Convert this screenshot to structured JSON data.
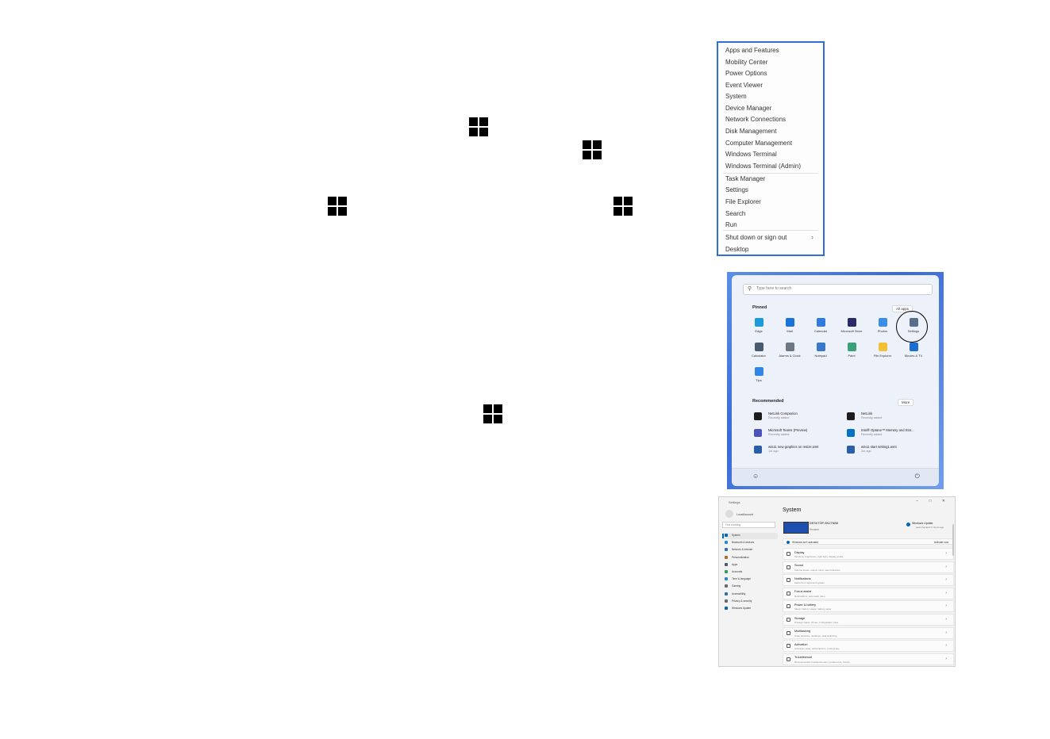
{
  "winx_menu": {
    "items": [
      {
        "label": "Apps and Features"
      },
      {
        "label": "Mobility Center"
      },
      {
        "label": "Power Options"
      },
      {
        "label": "Event Viewer"
      },
      {
        "label": "System"
      },
      {
        "label": "Device Manager"
      },
      {
        "label": "Network Connections"
      },
      {
        "label": "Disk Management"
      },
      {
        "label": "Computer Management"
      },
      {
        "label": "Windows Terminal"
      },
      {
        "label": "Windows Terminal (Admin)"
      },
      {
        "label": "Task Manager"
      },
      {
        "label": "Settings"
      },
      {
        "label": "File Explorer"
      },
      {
        "label": "Search"
      },
      {
        "label": "Run"
      },
      {
        "label": "Shut down or sign out",
        "submenu": true
      },
      {
        "label": "Desktop"
      }
    ]
  },
  "start_menu": {
    "search_placeholder": "Type here to search",
    "pinned_label": "Pinned",
    "all_apps_label": "All apps",
    "pinned_apps": [
      {
        "label": "Edge",
        "color": "#1b9bd8"
      },
      {
        "label": "Mail",
        "color": "#1a73d6"
      },
      {
        "label": "Calendar",
        "color": "#2f7be0"
      },
      {
        "label": "Microsoft Store",
        "color": "#2b2b6a"
      },
      {
        "label": "Photos",
        "color": "#3b8ee6"
      },
      {
        "label": "Settings",
        "color": "#5a6f8c"
      },
      {
        "label": "Calculator",
        "color": "#4a5a6e"
      },
      {
        "label": "Alarms & Clock",
        "color": "#6d7784"
      },
      {
        "label": "Notepad",
        "color": "#3a78c9"
      },
      {
        "label": "Paint",
        "color": "#3aa07a"
      },
      {
        "label": "File Explorer",
        "color": "#f2c035"
      },
      {
        "label": "Movies & TV",
        "color": "#1c6fd1"
      },
      {
        "label": "Tips",
        "color": "#2f86e8"
      }
    ],
    "recommended_label": "Recommended",
    "more_label": "More",
    "recommended": [
      {
        "title": "NetLink Companion",
        "sub": "Recently added",
        "color": "#1d1d1d"
      },
      {
        "title": "NetLink",
        "sub": "Recently added",
        "color": "#1d1d1d"
      },
      {
        "title": "Microsoft Teams (Preview)",
        "sub": "Recently added",
        "color": "#4b53bc"
      },
      {
        "title": "Intel® Optane™ Memory and Stor...",
        "sub": "Recently added",
        "color": "#0071c5"
      },
      {
        "title": "win11 new graphics on resize.wmt",
        "sub": "1m ago",
        "color": "#2a5ea8"
      },
      {
        "title": "win11 start setting1.wmt",
        "sub": "2m ago",
        "color": "#2a5ea8"
      }
    ]
  },
  "settings_window": {
    "window_title": "Settings",
    "window_controls": "–  □  ✕",
    "user_name": "LocalAccount",
    "find_placeholder": "Find a setting",
    "nav": [
      {
        "label": "System",
        "color": "#0067c0",
        "selected": true
      },
      {
        "label": "Bluetooth & devices",
        "color": "#2b88d8"
      },
      {
        "label": "Network & internet",
        "color": "#2b6fb8"
      },
      {
        "label": "Personalization",
        "color": "#b36b2a"
      },
      {
        "label": "Apps",
        "color": "#4a5870"
      },
      {
        "label": "Accounts",
        "color": "#2aa05a"
      },
      {
        "label": "Time & language",
        "color": "#2b88d8"
      },
      {
        "label": "Gaming",
        "color": "#6a6a6a"
      },
      {
        "label": "Accessibility",
        "color": "#2b6fb8"
      },
      {
        "label": "Privacy & security",
        "color": "#6a6a6a"
      },
      {
        "label": "Windows Update",
        "color": "#0067c0"
      }
    ],
    "page_title": "System",
    "device_name": "DESKTOP-5N1TNB8",
    "device_sub": "Rename",
    "windows_update": "Windows Update",
    "windows_update_sub": "Last checked: 6 hours ago",
    "activation_text": "Windows isn't activated",
    "activation_button": "Activate now",
    "rows": [
      {
        "title": "Display",
        "sub": "Monitors, brightness, night light, display profile"
      },
      {
        "title": "Sound",
        "sub": "Volume levels, output, input, sound devices"
      },
      {
        "title": "Notifications",
        "sub": "Alerts from apps and system"
      },
      {
        "title": "Focus assist",
        "sub": "Notifications, automatic rules"
      },
      {
        "title": "Power & battery",
        "sub": "Sleep, battery usage, battery saver"
      },
      {
        "title": "Storage",
        "sub": "Storage space, drives, configuration rules"
      },
      {
        "title": "Multitasking",
        "sub": "Snap windows, desktops, task switching"
      },
      {
        "title": "Activation",
        "sub": "Activation state, subscriptions, product key"
      },
      {
        "title": "Troubleshoot",
        "sub": "Recommended troubleshooters, preferences, history"
      }
    ]
  }
}
